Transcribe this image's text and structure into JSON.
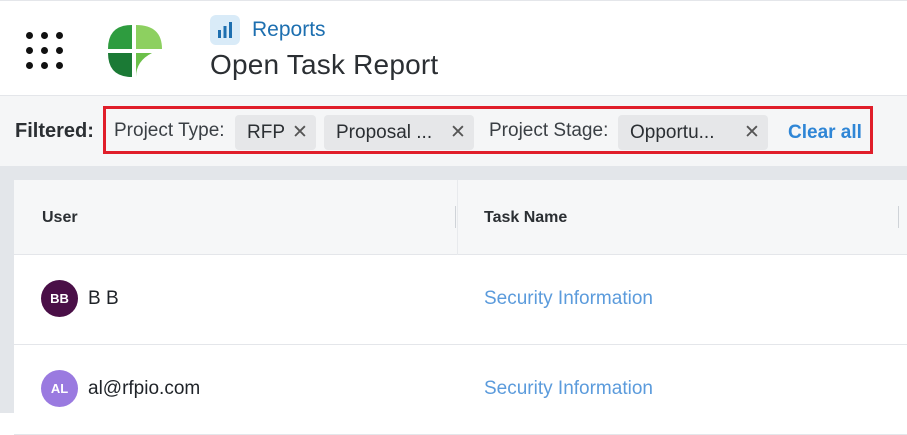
{
  "header": {
    "breadcrumb": "Reports",
    "title": "Open Task Report",
    "breadcrumb_icon": "bar-chart-icon",
    "menu_icon": "apps-grid-icon",
    "logo_colors": [
      "#6cc04a",
      "#2e9c3f",
      "#1b7a35",
      "#8dd060"
    ]
  },
  "filters": {
    "label": "Filtered:",
    "groups": [
      {
        "label": "Project Type:",
        "chips": [
          "RFP",
          "Proposal ..."
        ]
      },
      {
        "label": "Project Stage:",
        "chips": [
          "Opportu..."
        ]
      }
    ],
    "clear_all": "Clear all",
    "highlight_color": "#e01e2a"
  },
  "table": {
    "columns": [
      "User",
      "Task Name"
    ],
    "rows": [
      {
        "initials": "BB",
        "avatar_color": "#4a0f47",
        "user": "B B",
        "task": "Security Information"
      },
      {
        "initials": "AL",
        "avatar_color": "#9a7ae0",
        "user": "al@rfpio.com",
        "task": "Security Information"
      }
    ]
  }
}
